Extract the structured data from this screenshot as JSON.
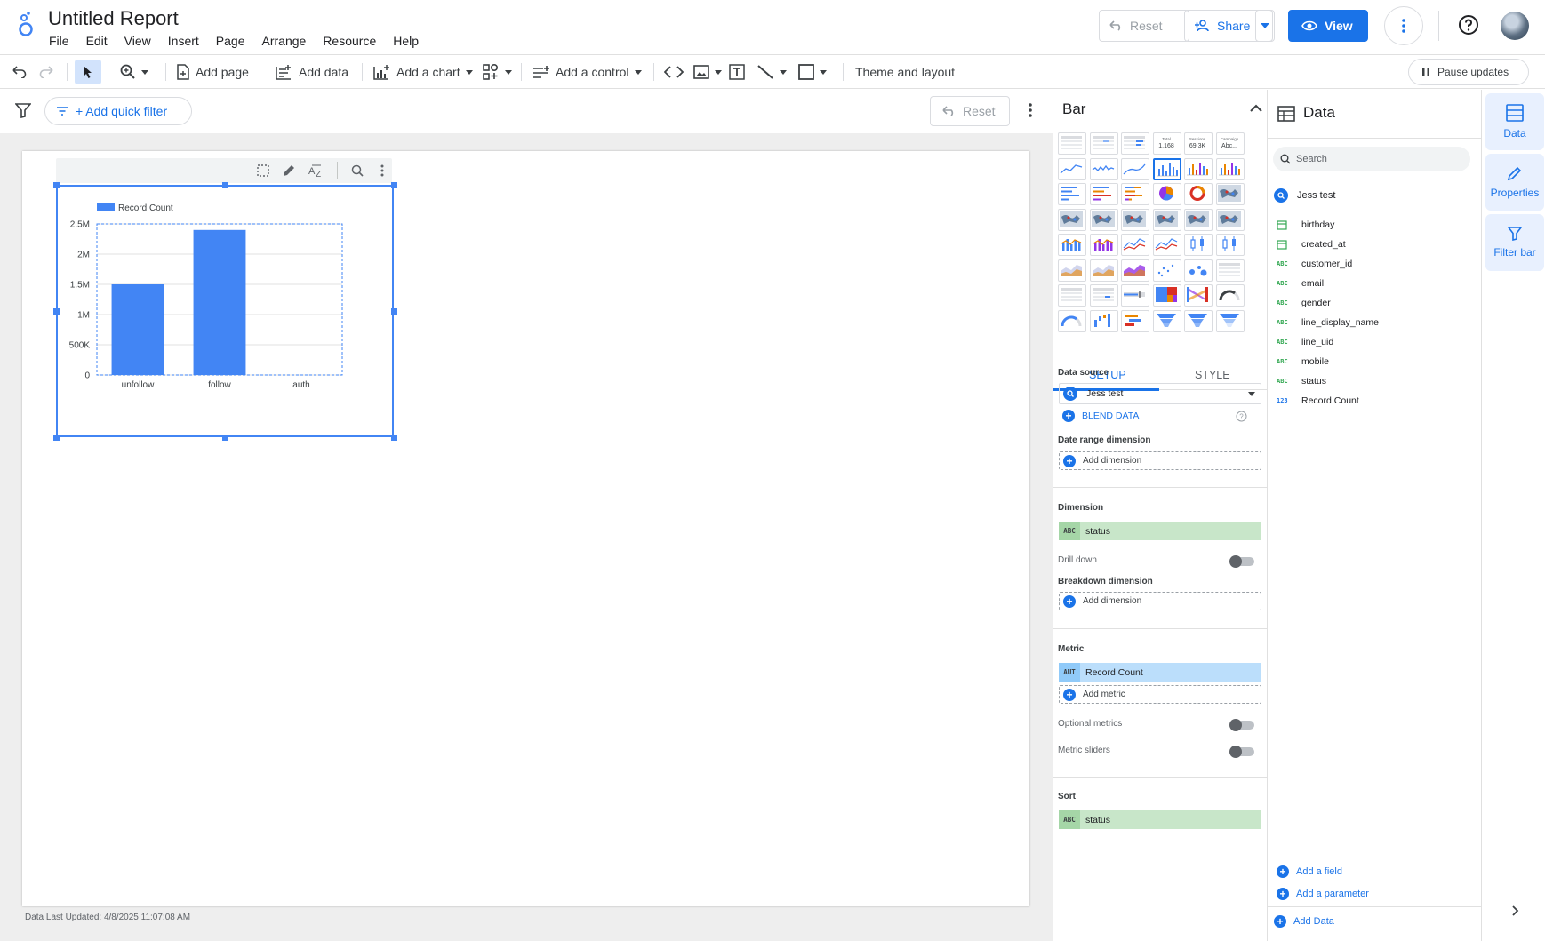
{
  "header": {
    "title": "Untitled Report",
    "menu": [
      "File",
      "Edit",
      "View",
      "Insert",
      "Page",
      "Arrange",
      "Resource",
      "Help"
    ],
    "reset_label": "Reset",
    "share_label": "Share",
    "view_label": "View"
  },
  "toolbar": {
    "add_page": "Add page",
    "add_data": "Add data",
    "add_chart": "Add a chart",
    "add_control": "Add a control",
    "theme_layout": "Theme and layout",
    "pause_updates": "Pause updates"
  },
  "filter_bar": {
    "quick_filter": "+ Add quick filter",
    "reset_label": "Reset"
  },
  "canvas": {
    "footer": "Data Last Updated: 4/8/2025 11:07:08 AM"
  },
  "chart_data": {
    "type": "bar",
    "categories": [
      "unfollow",
      "follow",
      "auth"
    ],
    "series": [
      {
        "name": "Record Count",
        "values": [
          1500000,
          2400000,
          0
        ]
      }
    ],
    "yticks": [
      "0",
      "500K",
      "1M",
      "1.5M",
      "2M",
      "2.5M"
    ],
    "ylim": [
      0,
      2500000
    ],
    "legend": "top-left",
    "bar_color": "#4285f4",
    "grid": true
  },
  "bar_panel": {
    "title": "Bar",
    "thumb_texts": {
      "total_label": "Total",
      "total_value": "1,168",
      "sessions_label": "Sessions",
      "sessions_value": "69.3K",
      "campaign_label": "Campaign",
      "campaign_value": "Abc..."
    },
    "tabs": {
      "setup": "SETUP",
      "style": "STYLE"
    },
    "data_source_label": "Data source",
    "data_source_value": "Jess test",
    "blend_data": "BLEND DATA",
    "date_range_label": "Date range dimension",
    "add_dimension": "Add dimension",
    "dimension_label": "Dimension",
    "dimension_type": "ABC",
    "dimension_value": "status",
    "drill_down": "Drill down",
    "breakdown_label": "Breakdown dimension",
    "metric_label": "Metric",
    "metric_type": "AUT",
    "metric_value": "Record Count",
    "add_metric": "Add metric",
    "optional_metrics": "Optional metrics",
    "metric_sliders": "Metric sliders",
    "sort_label": "Sort",
    "sort_type": "ABC",
    "sort_value": "status"
  },
  "data_panel": {
    "title": "Data",
    "search_placeholder": "Search",
    "data_source": "Jess test",
    "fields": [
      {
        "type": "date",
        "name": "birthday"
      },
      {
        "type": "date",
        "name": "created_at"
      },
      {
        "type": "ABC",
        "name": "customer_id"
      },
      {
        "type": "ABC",
        "name": "email"
      },
      {
        "type": "ABC",
        "name": "gender"
      },
      {
        "type": "ABC",
        "name": "line_display_name"
      },
      {
        "type": "ABC",
        "name": "line_uid"
      },
      {
        "type": "ABC",
        "name": "mobile"
      },
      {
        "type": "ABC",
        "name": "status"
      },
      {
        "type": "123",
        "name": "Record Count"
      }
    ],
    "add_field": "Add a field",
    "add_parameter": "Add a parameter",
    "add_data": "Add Data"
  },
  "rail": {
    "data": "Data",
    "properties": "Properties",
    "filter_bar": "Filter bar"
  },
  "colors": {
    "accent": "#1a73e8",
    "dimension_chip": "#c8e6c9",
    "metric_chip": "#bbdefb"
  }
}
